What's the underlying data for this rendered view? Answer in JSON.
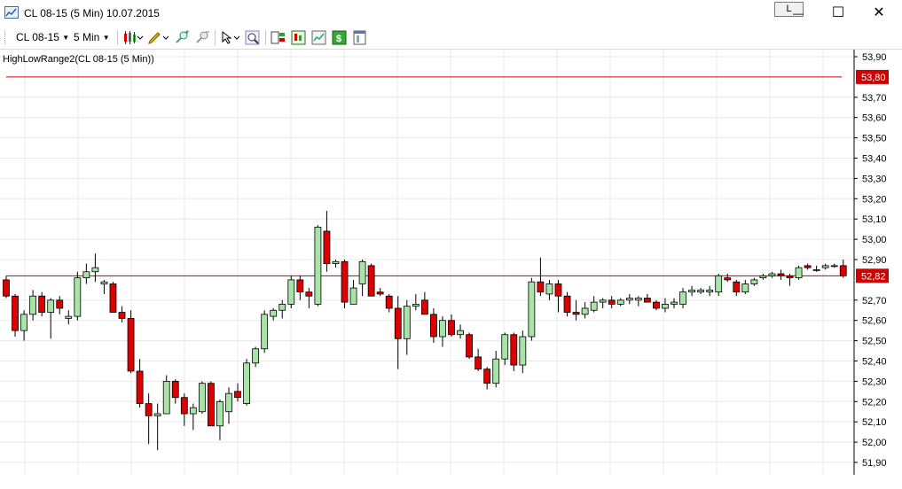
{
  "window": {
    "title": "CL 08-15 (5 Min)  10.07.2015",
    "link_button": "L",
    "minimize": "—",
    "maximize": "☐",
    "close": "✕"
  },
  "toolbar": {
    "instrument": "CL 08-15",
    "interval": "5 Min",
    "icons": [
      "candlestick-style-icon",
      "draw-pencil-icon",
      "zoom-in-icon",
      "zoom-out-icon",
      "cursor-select-icon",
      "magnifier-icon",
      "chart-trader-icon",
      "strategy-icon",
      "indicators-icon",
      "dollar-icon",
      "properties-icon"
    ]
  },
  "chart_data": {
    "type": "candlestick",
    "indicator_label": "HighLowRange2(CL 08-15 (5 Min))",
    "ylim": [
      51.86,
      53.96
    ],
    "y_ticks": [
      "53,90",
      "53,70",
      "53,60",
      "53,50",
      "53,40",
      "53,30",
      "53,20",
      "53,10",
      "53,00",
      "52,90",
      "52,70",
      "52,60",
      "52,50",
      "52,40",
      "52,30",
      "52,20",
      "52,10",
      "52,00",
      "51,90"
    ],
    "tick_values": [
      53.9,
      53.7,
      53.6,
      53.5,
      53.4,
      53.3,
      53.2,
      53.1,
      53.0,
      52.9,
      52.7,
      52.6,
      52.5,
      52.4,
      52.3,
      52.2,
      52.1,
      52.0,
      51.9
    ],
    "hlines": [
      {
        "value": 53.8,
        "label": "53,80",
        "color": "#cc0000"
      },
      {
        "value": 52.82,
        "label": "52,82",
        "color": "#cc0000"
      }
    ],
    "up_color": "#a8e3a8",
    "down_color": "#dd0000",
    "candles": [
      [
        52.8,
        52.82,
        52.71,
        52.72
      ],
      [
        52.72,
        52.73,
        52.52,
        52.55
      ],
      [
        52.55,
        52.65,
        52.5,
        52.63
      ],
      [
        52.63,
        52.75,
        52.6,
        52.72
      ],
      [
        52.72,
        52.74,
        52.62,
        52.64
      ],
      [
        52.64,
        52.71,
        52.51,
        52.7
      ],
      [
        52.7,
        52.72,
        52.63,
        52.66
      ],
      [
        52.61,
        52.65,
        52.58,
        52.62
      ],
      [
        52.62,
        52.84,
        52.6,
        52.81
      ],
      [
        52.81,
        52.88,
        52.78,
        52.84
      ],
      [
        52.84,
        52.93,
        52.79,
        52.86
      ],
      [
        52.78,
        52.8,
        52.73,
        52.79
      ],
      [
        52.78,
        52.79,
        52.64,
        52.64
      ],
      [
        52.64,
        52.67,
        52.59,
        52.61
      ],
      [
        52.61,
        52.65,
        52.34,
        52.35
      ],
      [
        52.35,
        52.41,
        52.17,
        52.19
      ],
      [
        52.19,
        52.24,
        51.99,
        52.13
      ],
      [
        52.13,
        52.19,
        51.96,
        52.14
      ],
      [
        52.14,
        52.33,
        52.14,
        52.3
      ],
      [
        52.3,
        52.31,
        52.19,
        52.22
      ],
      [
        52.22,
        52.24,
        52.08,
        52.14
      ],
      [
        52.14,
        52.19,
        52.06,
        52.17
      ],
      [
        52.15,
        52.3,
        52.14,
        52.29
      ],
      [
        52.29,
        52.3,
        52.08,
        52.08
      ],
      [
        52.08,
        52.21,
        52.01,
        52.2
      ],
      [
        52.15,
        52.27,
        52.09,
        52.24
      ],
      [
        52.25,
        52.29,
        52.2,
        52.22
      ],
      [
        52.19,
        52.41,
        52.18,
        52.39
      ],
      [
        52.39,
        52.47,
        52.37,
        52.46
      ],
      [
        52.46,
        52.65,
        52.44,
        52.63
      ],
      [
        52.62,
        52.66,
        52.6,
        52.65
      ],
      [
        52.65,
        52.7,
        52.61,
        52.68
      ],
      [
        52.68,
        52.82,
        52.66,
        52.8
      ],
      [
        52.8,
        52.82,
        52.7,
        52.74
      ],
      [
        52.74,
        52.76,
        52.66,
        52.72
      ],
      [
        52.68,
        53.07,
        52.67,
        53.06
      ],
      [
        53.04,
        53.14,
        52.84,
        52.88
      ],
      [
        52.88,
        52.9,
        52.86,
        52.89
      ],
      [
        52.89,
        52.9,
        52.66,
        52.69
      ],
      [
        52.68,
        52.8,
        52.68,
        52.76
      ],
      [
        52.78,
        52.9,
        52.72,
        52.89
      ],
      [
        52.87,
        52.88,
        52.72,
        52.72
      ],
      [
        52.74,
        52.76,
        52.72,
        52.73
      ],
      [
        52.72,
        52.73,
        52.64,
        52.66
      ],
      [
        52.66,
        52.72,
        52.36,
        52.51
      ],
      [
        52.51,
        52.7,
        52.43,
        52.67
      ],
      [
        52.67,
        52.73,
        52.65,
        52.68
      ],
      [
        52.7,
        52.74,
        52.64,
        52.63
      ],
      [
        52.63,
        52.66,
        52.49,
        52.52
      ],
      [
        52.52,
        52.62,
        52.47,
        52.6
      ],
      [
        52.6,
        52.63,
        52.52,
        52.53
      ],
      [
        52.53,
        52.58,
        52.51,
        52.55
      ],
      [
        52.53,
        52.54,
        52.41,
        52.42
      ],
      [
        52.42,
        52.46,
        52.35,
        52.36
      ],
      [
        52.36,
        52.37,
        52.26,
        52.29
      ],
      [
        52.29,
        52.45,
        52.27,
        52.41
      ],
      [
        52.41,
        52.54,
        52.38,
        52.53
      ],
      [
        52.53,
        52.54,
        52.35,
        52.38
      ],
      [
        52.38,
        52.55,
        52.34,
        52.52
      ],
      [
        52.52,
        52.81,
        52.5,
        52.79
      ],
      [
        52.79,
        52.91,
        52.72,
        52.74
      ],
      [
        52.73,
        52.8,
        52.7,
        52.78
      ],
      [
        52.78,
        52.8,
        52.64,
        52.72
      ],
      [
        52.72,
        52.74,
        52.62,
        52.64
      ],
      [
        52.64,
        52.7,
        52.6,
        52.63
      ],
      [
        52.63,
        52.69,
        52.61,
        52.66
      ],
      [
        52.65,
        52.72,
        52.64,
        52.69
      ],
      [
        52.69,
        52.71,
        52.66,
        52.7
      ],
      [
        52.7,
        52.72,
        52.66,
        52.68
      ],
      [
        52.68,
        52.71,
        52.67,
        52.7
      ],
      [
        52.7,
        52.73,
        52.68,
        52.71
      ],
      [
        52.7,
        52.72,
        52.67,
        52.71
      ],
      [
        52.71,
        52.73,
        52.69,
        52.69
      ],
      [
        52.69,
        52.7,
        52.65,
        52.66
      ],
      [
        52.66,
        52.71,
        52.64,
        52.68
      ],
      [
        52.68,
        52.71,
        52.66,
        52.69
      ],
      [
        52.68,
        52.76,
        52.66,
        52.74
      ],
      [
        52.74,
        52.77,
        52.72,
        52.75
      ],
      [
        52.74,
        52.76,
        52.73,
        52.75
      ],
      [
        52.74,
        52.77,
        52.72,
        52.75
      ],
      [
        52.74,
        52.83,
        52.72,
        52.82
      ],
      [
        52.81,
        52.83,
        52.79,
        52.8
      ],
      [
        52.79,
        52.8,
        52.72,
        52.74
      ],
      [
        52.74,
        52.8,
        52.73,
        52.78
      ],
      [
        52.78,
        52.81,
        52.77,
        52.8
      ],
      [
        52.81,
        52.83,
        52.8,
        52.82
      ],
      [
        52.82,
        52.84,
        52.81,
        52.83
      ],
      [
        52.83,
        52.85,
        52.8,
        52.82
      ],
      [
        52.82,
        52.83,
        52.77,
        52.81
      ],
      [
        52.81,
        52.87,
        52.8,
        52.86
      ],
      [
        52.87,
        52.88,
        52.85,
        52.86
      ],
      [
        52.85,
        52.87,
        52.84,
        52.85
      ],
      [
        52.86,
        52.88,
        52.85,
        52.87
      ],
      [
        52.87,
        52.88,
        52.86,
        52.87
      ],
      [
        52.87,
        52.9,
        52.81,
        52.82
      ]
    ]
  }
}
